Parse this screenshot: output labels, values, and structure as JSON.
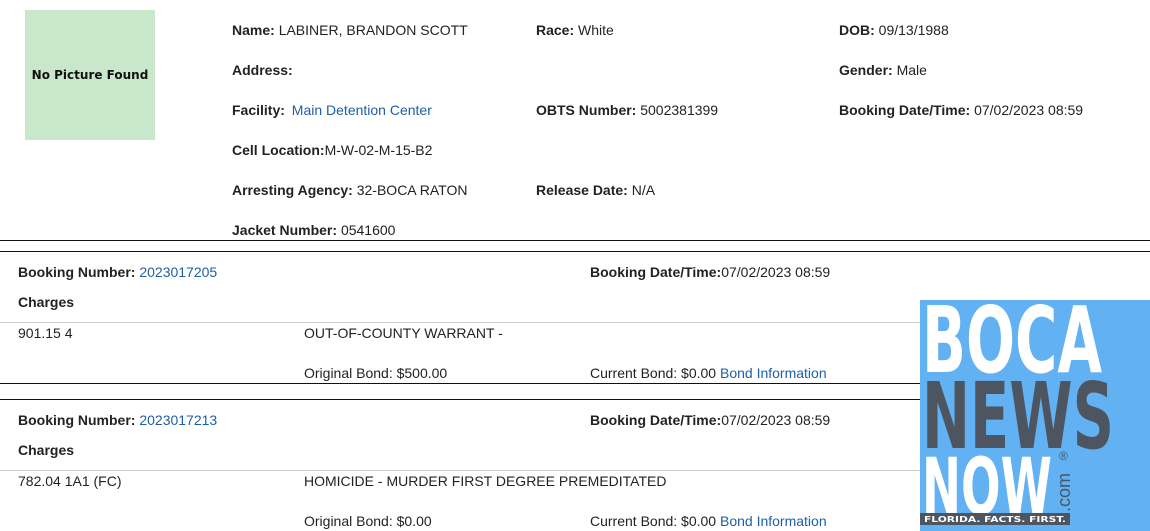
{
  "inmate": {
    "photo_text": "No Picture Found",
    "name_label": "Name:",
    "name": "LABINER, BRANDON SCOTT",
    "race_label": "Race:",
    "race": "White",
    "dob_label": "DOB:",
    "dob": "09/13/1988",
    "address_label": "Address:",
    "gender_label": "Gender:",
    "gender": "Male",
    "facility_label": "Facility:",
    "facility": "Main Detention Center",
    "obts_label": "OBTS Number:",
    "obts": "5002381399",
    "booking_dt_label": "Booking Date/Time:",
    "booking_dt": "07/02/2023 08:59",
    "cell_label": "Cell Location:",
    "cell": "M-W-02-M-15-B2",
    "agency_label": "Arresting Agency:",
    "agency": "32-BOCA RATON",
    "release_label": "Release Date:",
    "release": "N/A",
    "jacket_label": "Jacket Number:",
    "jacket": "0541600"
  },
  "bookings": [
    {
      "number_label": "Booking Number:",
      "number": "2023017205",
      "dt_label": "Booking Date/Time:",
      "dt": "07/02/2023 08:59",
      "charges_label": "Charges",
      "statute": "901.15 4",
      "description": "OUT-OF-COUNTY WARRANT -",
      "original_bond": "Original Bond: $500.00",
      "current_bond": "Current Bond: $0.00",
      "bond_link": "Bond Information"
    },
    {
      "number_label": "Booking Number:",
      "number": "2023017213",
      "dt_label": "Booking Date/Time:",
      "dt": "07/02/2023 08:59",
      "charges_label": "Charges",
      "statute": "782.04 1A1 (FC)",
      "description": "HOMICIDE - MURDER FIRST DEGREE PREMEDITATED",
      "original_bond": "Original Bond: $0.00",
      "current_bond": "Current Bond: $0.00",
      "bond_link": "Bond Information"
    }
  ],
  "logo": {
    "line1": "BOCA",
    "line2": "NEWS",
    "line3": "NOW",
    "dotcom": ".com",
    "registered": "®",
    "tagline": "FLORIDA. FACTS. FIRST.",
    "colors": {
      "background": "#62b1f2",
      "light": "#ffffff",
      "dark": "#4d5560"
    }
  }
}
